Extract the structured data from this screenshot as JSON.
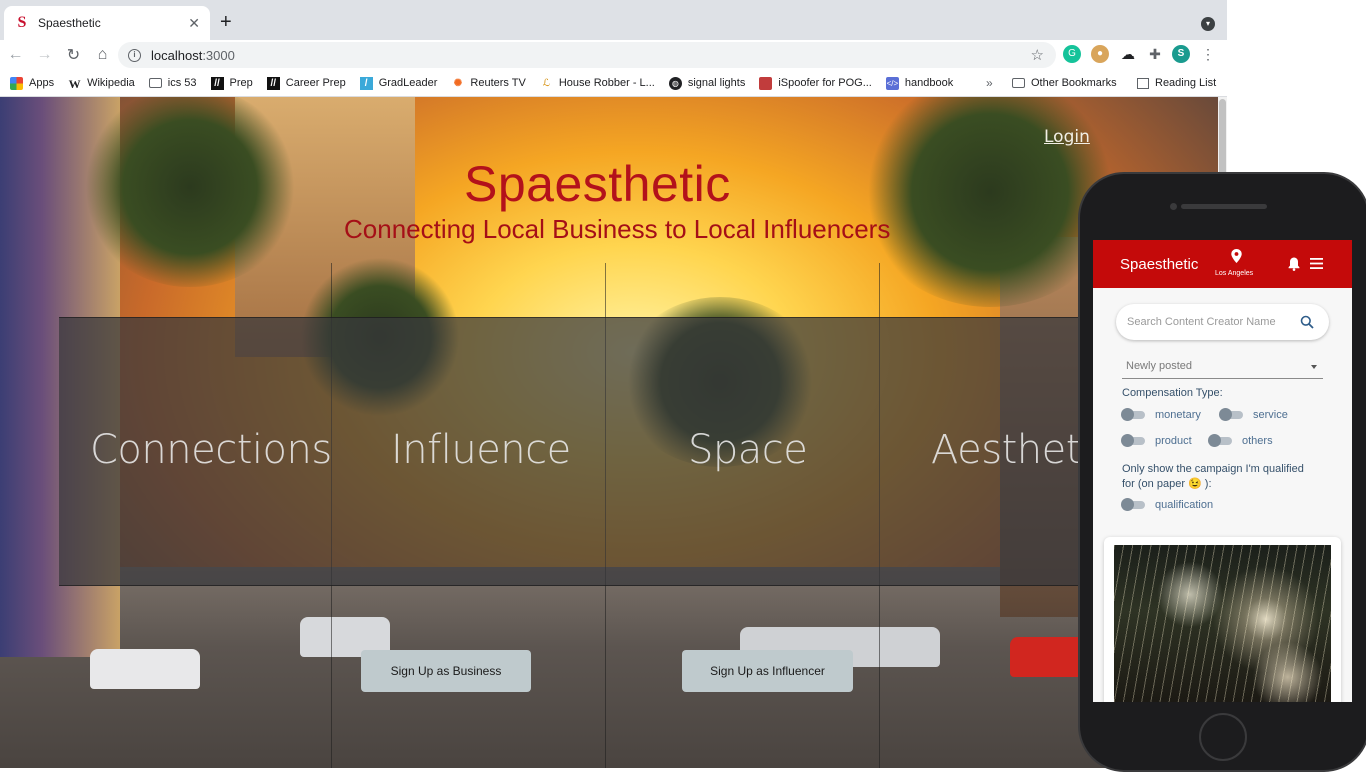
{
  "browser": {
    "tab_title": "Spaesthetic",
    "url_host": "localhost",
    "url_port": ":3000",
    "bookmarks": [
      {
        "label": "Apps",
        "icon": "apps-grid-icon"
      },
      {
        "label": "Wikipedia",
        "icon": "wikipedia-w-icon"
      },
      {
        "label": "ics 53",
        "icon": "folder-icon"
      },
      {
        "label": "Prep",
        "icon": "slash-icon"
      },
      {
        "label": "Career Prep",
        "icon": "slash-icon"
      },
      {
        "label": "GradLeader",
        "icon": "gradleader-icon"
      },
      {
        "label": "Reuters TV",
        "icon": "reuters-icon"
      },
      {
        "label": "House Robber - L...",
        "icon": "leetcode-icon"
      },
      {
        "label": "signal lights",
        "icon": "globe-icon"
      },
      {
        "label": "iSpoofer for POG...",
        "icon": "ispoofer-icon"
      },
      {
        "label": "handbook",
        "icon": "handbook-icon"
      }
    ],
    "more_bookmarks": "»",
    "other_bookmarks": "Other Bookmarks",
    "reading_list": "Reading List",
    "profile_initial": "S"
  },
  "hero": {
    "login": "Login",
    "title": "Spaesthetic",
    "subtitle": "Connecting Local Business to Local Influencers",
    "words": [
      "Connections",
      "Influence",
      "Space",
      "Aesthetic"
    ],
    "signup_business": "Sign Up as Business",
    "signup_influencer": "Sign Up as Influencer"
  },
  "mobile": {
    "app_title": "Spaesthetic",
    "location": "Los Angeles",
    "search_placeholder": "Search Content Creator Name",
    "sort_selected": "Newly posted",
    "compensation_label": "Compensation Type:",
    "toggles": [
      "monetary",
      "service",
      "product",
      "others"
    ],
    "qualified_text": "Only show the campaign I'm qualified for (on paper 😉 ):",
    "qualification_toggle": "qualification"
  },
  "colors": {
    "brand_red": "#c40a0a",
    "title_red": "#b3121b"
  }
}
